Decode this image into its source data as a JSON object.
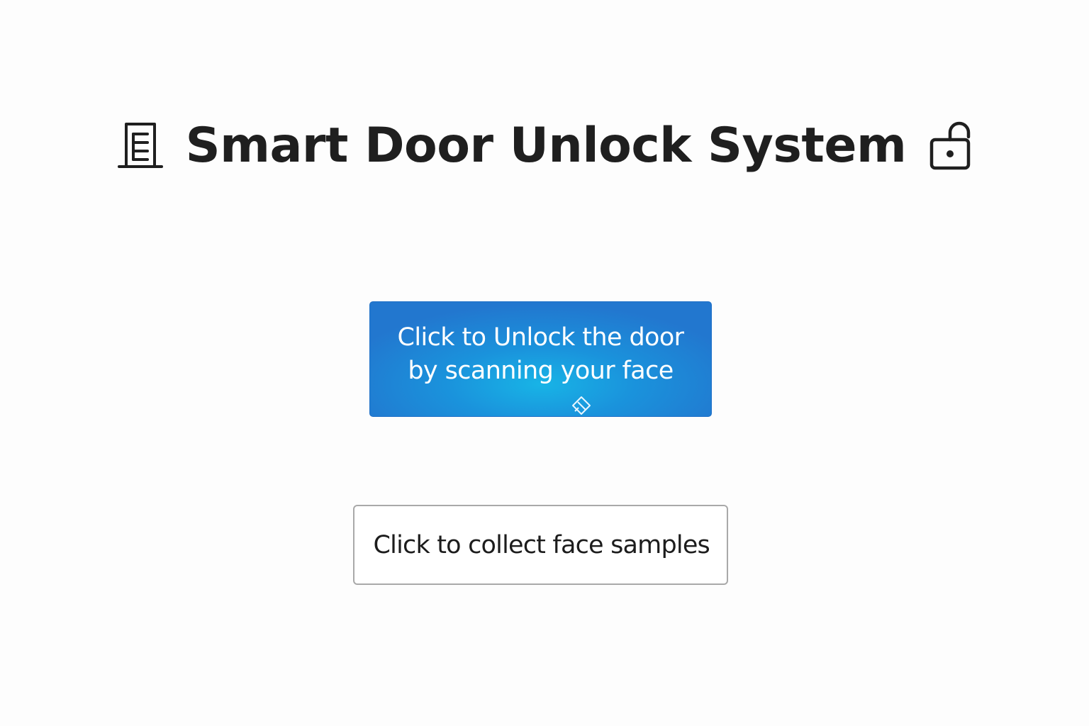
{
  "header": {
    "title": "Smart Door Unlock System",
    "left_icon": "door-icon",
    "right_icon": "unlock-icon"
  },
  "unlock_button": {
    "line1": "Click to Unlock the door",
    "line2": "by scanning your face",
    "overlay_icon": "pointer-cursor-icon"
  },
  "collect_button": {
    "label": "Click to collect face samples"
  },
  "colors": {
    "background": "#fdfdfd",
    "title_text": "#1f1f1f",
    "primary_button": "#2277cf",
    "primary_button_glow": "#18b4e6",
    "secondary_button_border": "#a9a9a9"
  }
}
